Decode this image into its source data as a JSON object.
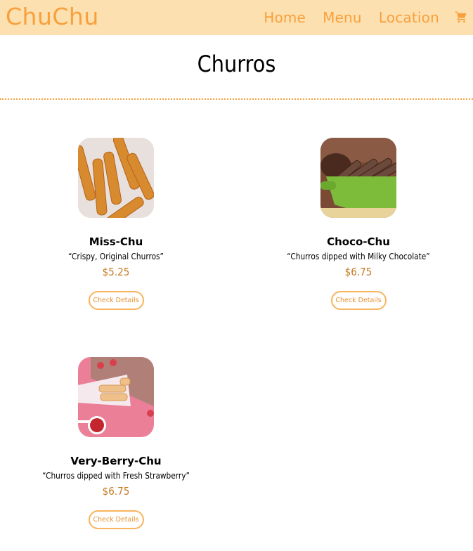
{
  "navbar": {
    "brand": "ChuChu",
    "links": [
      "Home",
      "Menu",
      "Location"
    ],
    "cart_icon": "shopping-cart-icon",
    "colors": {
      "background": "#fde0b0",
      "accent": "#f8a03c"
    }
  },
  "page": {
    "title": "Churros",
    "separator_color": "#f8a03c"
  },
  "products": [
    {
      "name": "Miss-Chu",
      "description": "“Crispy, Original Churros”",
      "price": "$5.25",
      "button_label": "Check Details",
      "image": "churros-plain-image"
    },
    {
      "name": "Choco-Chu",
      "description": "“Churros dipped with Milky Chocolate”",
      "price": "$6.75",
      "button_label": "Check Details",
      "image": "churros-chocolate-image"
    },
    {
      "name": "Very-Berry-Chu",
      "description": "“Churros dipped with Fresh Strawberry”",
      "price": "$6.75",
      "button_label": "Check Details",
      "image": "churros-strawberry-image"
    }
  ],
  "colors": {
    "price": "#c57a22",
    "button_border": "#f8b45c"
  }
}
